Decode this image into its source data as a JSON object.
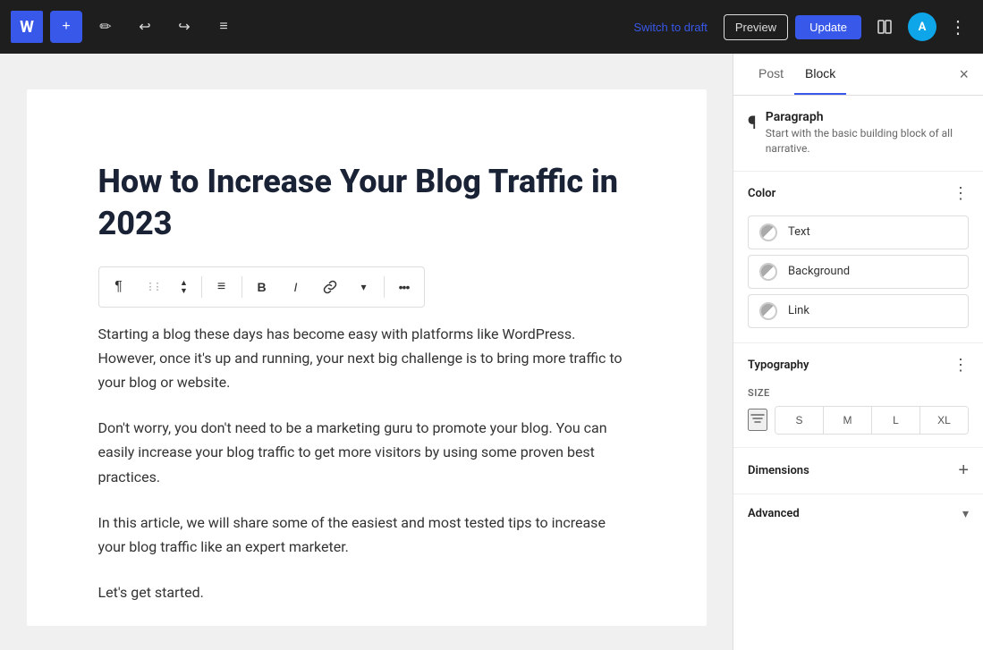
{
  "topbar": {
    "wp_logo": "W",
    "add_label": "+",
    "edit_label": "✏",
    "undo_label": "↩",
    "redo_label": "↪",
    "list_view_label": "≡",
    "switch_draft_label": "Switch to draft",
    "preview_label": "Preview",
    "update_label": "Update",
    "layout_icon": "⬜",
    "astra_label": "A",
    "more_label": "⋮"
  },
  "editor": {
    "title": "How to Increase Your Blog Traffic in 2023",
    "paragraphs": [
      "Starting a blog these days has become easy with platforms like WordPress. However, once it's up and running, your next big challenge is to bring more traffic to your blog or website.",
      "Don't worry, you don't need to be a marketing guru to promote your blog. You can easily increase your blog traffic to get more visitors by using some proven best practices.",
      "In this article, we will share some of the easiest and most tested tips to increase your blog traffic like an expert marketer.",
      "Let's get started."
    ]
  },
  "block_toolbar": {
    "paragraph_icon": "¶",
    "drag_icon": "⋮⋮",
    "move_up_icon": "▲",
    "move_down_icon": "▼",
    "align_icon": "≡",
    "bold_label": "B",
    "italic_label": "I",
    "link_icon": "🔗",
    "more_icon": "⋯",
    "dropdown_icon": "▾"
  },
  "sidebar": {
    "tab_post_label": "Post",
    "tab_block_label": "Block",
    "close_label": "×",
    "block_icon": "¶",
    "block_title": "Paragraph",
    "block_desc": "Start with the basic building block of all narrative.",
    "color_section": {
      "title": "Color",
      "more_icon": "⋮",
      "items": [
        {
          "label": "Text"
        },
        {
          "label": "Background"
        },
        {
          "label": "Link"
        }
      ]
    },
    "typography_section": {
      "title": "Typography",
      "more_icon": "⋮",
      "size_label": "SIZE",
      "filter_icon": "⇌",
      "size_options": [
        "S",
        "M",
        "L",
        "XL"
      ]
    },
    "dimensions_section": {
      "title": "Dimensions",
      "add_icon": "+"
    },
    "advanced_section": {
      "title": "Advanced",
      "chevron_icon": "▾"
    }
  }
}
